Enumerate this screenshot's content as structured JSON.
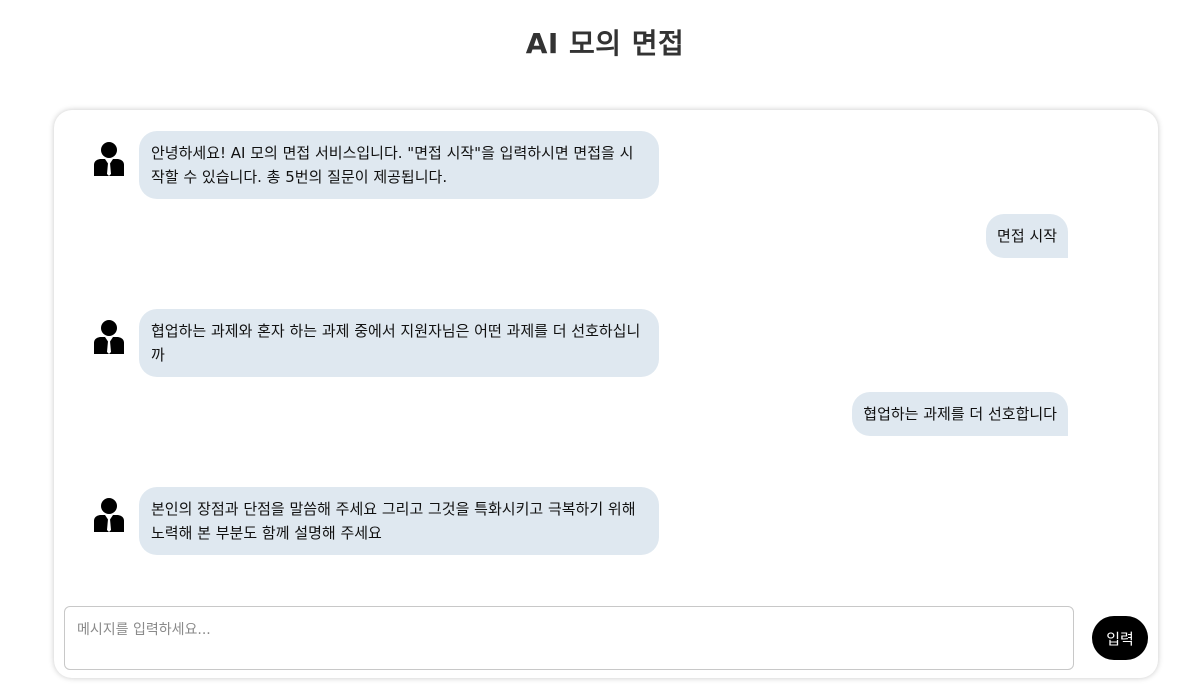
{
  "header": {
    "title": "AI 모의 면접"
  },
  "messages": [
    {
      "role": "bot",
      "text": "안녕하세요! AI 모의 면접 서비스입니다. \"면접 시작\"을 입력하시면 면접을 시작할 수 있습니다. 총 5번의 질문이 제공됩니다."
    },
    {
      "role": "user",
      "text": "면접 시작"
    },
    {
      "role": "bot",
      "text": "협업하는 과제와 혼자 하는 과제 중에서 지원자님은 어떤 과제를 더 선호하십니까"
    },
    {
      "role": "user",
      "text": "협업하는 과제를 더 선호합니다"
    },
    {
      "role": "bot",
      "text": "본인의 장점과 단점을 말씀해 주세요 그리고 그것을 특화시키고 극복하기 위해 노력해 본 부분도 함께 설명해 주세요"
    }
  ],
  "composer": {
    "placeholder": "메시지를 입력하세요...",
    "value": "",
    "send_label": "입력"
  },
  "icons": {
    "bot_avatar": "interviewer-person-icon"
  },
  "colors": {
    "bubble_bg": "#dfe8f0",
    "send_button_bg": "#000000",
    "send_button_text": "#ffffff",
    "title_text": "#333333"
  }
}
